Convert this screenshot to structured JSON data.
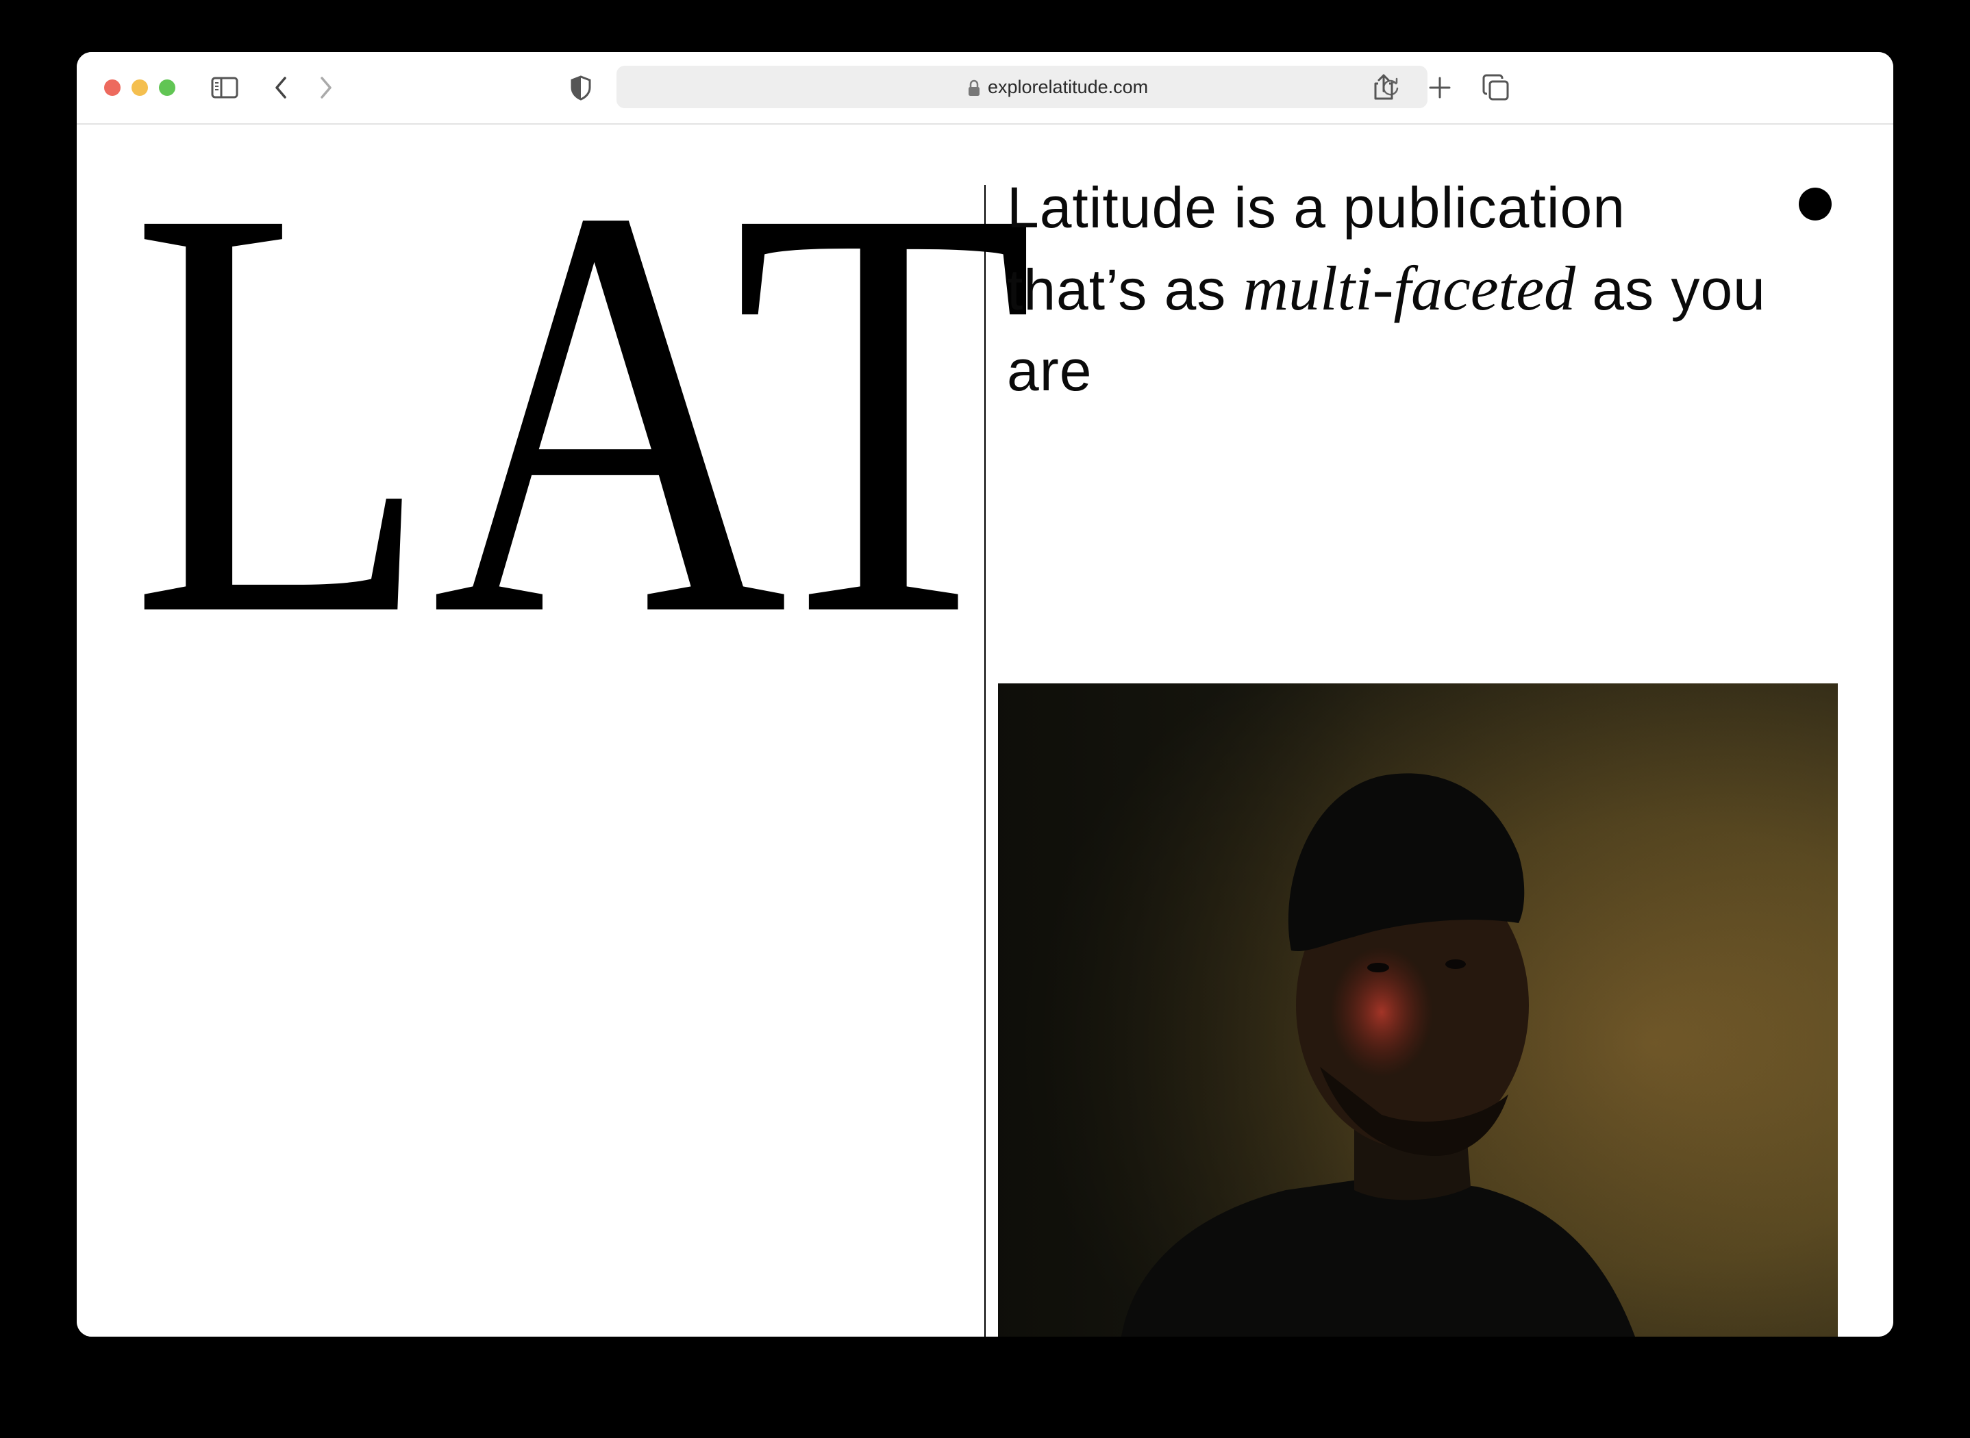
{
  "browser": {
    "url": "explorelatitude.com"
  },
  "site": {
    "wordmark": "LAT",
    "tagline": {
      "before": "Latitude is a publication that’s as ",
      "emphasis": "multi-faceted",
      "after": " as you are"
    }
  },
  "colors": {
    "background": "#ffffff",
    "text": "#0a0a0a",
    "window_frame": "#000000"
  },
  "icons": {
    "sidebar": "sidebar-icon",
    "back": "chevron-left-icon",
    "forward": "chevron-right-icon",
    "privacy": "shield-icon",
    "lock": "lock-icon",
    "reload": "reload-icon",
    "share": "share-icon",
    "new_tab": "plus-icon",
    "tabs": "tabs-overview-icon",
    "menu_dot": "dot-icon"
  }
}
